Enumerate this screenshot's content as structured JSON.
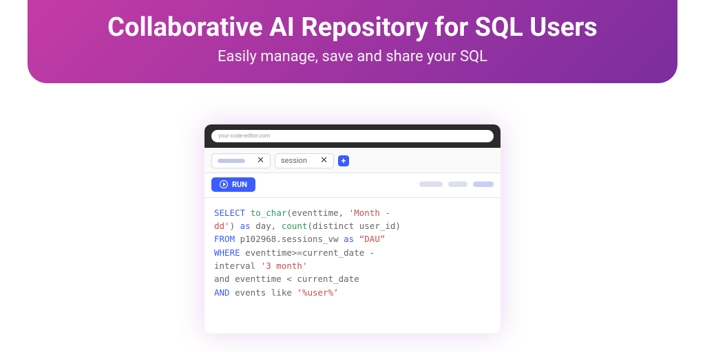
{
  "hero": {
    "title": "Collaborative AI Repository for SQL Users",
    "subtitle": "Easily manage, save and share your SQL"
  },
  "window": {
    "url": "your-code-editor.com",
    "tabs": [
      {
        "label": ""
      },
      {
        "label": "session"
      }
    ],
    "add_tab": "+",
    "run_label": "RUN"
  },
  "sql": {
    "kw_select": "SELECT",
    "fn_tochar": "to_char",
    "tochar_args_open": "(eventtime, ",
    "str_month": "'Month -\ndd'",
    "tochar_args_close": ") ",
    "kw_as1": "as",
    "day_lbl": " day, ",
    "fn_count": "count",
    "count_args": "(distinct user_id)",
    "kw_from": "FROM",
    "from_body": " p102968.sessions_vw ",
    "kw_as2": "as",
    "str_dau": " “DAU”",
    "kw_where": "WHERE",
    "where_body_a": " eventtime>=current_date -\ninterval ",
    "str_3month": "'3 month'",
    "and1": "and",
    "lt_body": " eventtime < current_date",
    "kw_and": "AND",
    "like_body": " events like ",
    "str_user": "‘%user%’"
  }
}
